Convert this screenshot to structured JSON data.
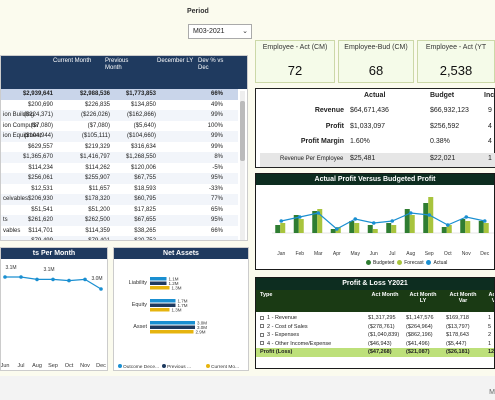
{
  "period": {
    "label": "Period",
    "value": "M03-2021"
  },
  "balance": {
    "headers": [
      "Current Month",
      "Previous Month",
      "December LY",
      "Dev % vs Dec"
    ],
    "rows": [
      {
        "label": "",
        "c1": "$2,939,641",
        "c2": "$2,988,536",
        "c3": "$1,773,853",
        "c4": "66%",
        "style": "total"
      },
      {
        "label": "",
        "c1": "$200,690",
        "c2": "$226,835",
        "c3": "$134,850",
        "c4": "49%",
        "style": ""
      },
      {
        "label": "ion Building",
        "c1": "($224,371)",
        "c2": "($226,026)",
        "c3": "($162,866)",
        "c4": "99%",
        "style": "alt"
      },
      {
        "label": "ion Computer",
        "c1": "($7,080)",
        "c2": "($7,080)",
        "c3": "($5,640)",
        "c4": "100%",
        "style": ""
      },
      {
        "label": "ion Equipment",
        "c1": "($104,944)",
        "c2": "($105,111)",
        "c3": "($104,660)",
        "c4": "99%",
        "style": "alt"
      },
      {
        "label": "",
        "c1": "$629,557",
        "c2": "$219,329",
        "c3": "$316,634",
        "c4": "99%",
        "style": ""
      },
      {
        "label": "",
        "c1": "$1,365,670",
        "c2": "$1,416,797",
        "c3": "$1,268,550",
        "c4": "8%",
        "style": "alt"
      },
      {
        "label": "",
        "c1": "$114,234",
        "c2": "$114,262",
        "c3": "$120,006",
        "c4": "-5%",
        "style": ""
      },
      {
        "label": "",
        "c1": "$256,061",
        "c2": "$255,907",
        "c3": "$67,755",
        "c4": "95%",
        "style": "alt"
      },
      {
        "label": "",
        "c1": "$12,531",
        "c2": "$11,657",
        "c3": "$18,593",
        "c4": "-33%",
        "style": ""
      },
      {
        "label": "ceivables",
        "c1": "$206,930",
        "c2": "$178,320",
        "c3": "$60,795",
        "c4": "77%",
        "style": "alt"
      },
      {
        "label": "",
        "c1": "$51,541",
        "c2": "$51,200",
        "c3": "$17,825",
        "c4": "65%",
        "style": ""
      },
      {
        "label": "ts",
        "c1": "$261,620",
        "c2": "$262,500",
        "c3": "$67,655",
        "c4": "95%",
        "style": "alt"
      },
      {
        "label": "vables",
        "c1": "$114,701",
        "c2": "$114,359",
        "c3": "$38,265",
        "c4": "66%",
        "style": ""
      },
      {
        "label": "",
        "c1": "$79,499",
        "c2": "$79,401",
        "c3": "$20,752",
        "c4": "-",
        "style": "alt"
      },
      {
        "label": "",
        "c1": "$1,675,329",
        "c2": "$1,675,329",
        "c3": "$938,757",
        "c4": "56%",
        "style": "total"
      },
      {
        "label": "",
        "c1": "$1,675,329",
        "c2": "$1,675,329",
        "c3": "$938,757",
        "c4": "",
        "style": ""
      },
      {
        "label": "",
        "c1": "$1,675,329",
        "c2": "$1,675,329",
        "c3": "$938,757",
        "c4": "56%",
        "style": "total"
      },
      {
        "label": "",
        "c1": "$1,311,580",
        "c2": "$1,309,288",
        "c3": "$838,355",
        "c4": "",
        "style": "total"
      }
    ]
  },
  "kpis": [
    {
      "title": "Employee - Act (CM)",
      "value": "72"
    },
    {
      "title": "Employee-Bud (CM)",
      "value": "68"
    },
    {
      "title": "Employee - Act (YT",
      "value": "2,538"
    }
  ],
  "profit_compare": {
    "headers": [
      "Actual",
      "Budget",
      "Inc"
    ],
    "rows": [
      {
        "label": "Revenue",
        "actual": "$64,671,436",
        "budget": "$66,932,123",
        "inc": "9"
      },
      {
        "label": "Profit",
        "actual": "$1,033,097",
        "budget": "$256,592",
        "inc": "4"
      },
      {
        "label": "Profit Margin",
        "actual": "1.60%",
        "budget": "0.38%",
        "inc": "4"
      }
    ],
    "rpe": {
      "label": "Revenue Per Employee",
      "actual": "$25,481",
      "budget": "$22,021",
      "inc": "1"
    }
  },
  "actual_profit_chart": {
    "title": "Actual Profit Versus Budgeted Profit",
    "months": [
      "Jan",
      "Feb",
      "Mar",
      "Apr",
      "May",
      "Jun",
      "Jul",
      "Aug",
      "Sep",
      "Oct",
      "Nov",
      "Dec"
    ],
    "legend": [
      "Budgeted",
      "Forecast",
      "Actual"
    ],
    "colors": {
      "budget": "#2f7d32",
      "forecast": "#a8c43d",
      "actual": "#1a8fd1"
    },
    "chart_data": {
      "type": "bar",
      "categories": [
        "Jan",
        "Feb",
        "Mar",
        "Apr",
        "May",
        "Jun",
        "Jul",
        "Aug",
        "Sep",
        "Oct",
        "Nov",
        "Dec"
      ],
      "series": [
        {
          "name": "Budgeted",
          "values": [
            0.2,
            0.45,
            0.55,
            0.1,
            0.3,
            0.2,
            0.25,
            0.6,
            0.75,
            0.15,
            0.35,
            0.3
          ]
        },
        {
          "name": "Forecast",
          "values": [
            0.25,
            0.35,
            0.6,
            0.15,
            0.25,
            0.1,
            0.2,
            0.45,
            0.9,
            0.2,
            0.3,
            0.25
          ]
        },
        {
          "name": "Actual",
          "values": [
            0.3,
            0.4,
            0.5,
            0.1,
            0.35,
            0.25,
            0.3,
            0.5,
            0.45,
            0.2,
            0.4,
            0.3
          ]
        }
      ]
    }
  },
  "pl": {
    "title": "Profit & Loss Y2021",
    "headers": [
      "Type",
      "Act Month",
      "Act Month LY",
      "Act Month Var",
      "Act M Var"
    ],
    "rows": [
      {
        "label": "1 - Revenue",
        "a": "$1,317,295",
        "b": "$1,147,576",
        "c": "$169,718",
        "d": "1"
      },
      {
        "label": "2 - Cost of Sales",
        "a": "($278,761)",
        "b": "($264,964)",
        "c": "($13,797)",
        "d": "5"
      },
      {
        "label": "3 - Expenses",
        "a": "($1,040,839)",
        "b": "($862,196)",
        "c": "$178,643",
        "d": "2"
      },
      {
        "label": "4 - Other Income/Expense",
        "a": "($46,943)",
        "b": "($41,496)",
        "c": "($5,447)",
        "d": "1"
      }
    ],
    "total": {
      "label": "Profit (Loss)",
      "a": "($47,268)",
      "b": "($21,087)",
      "c": "($26,181)",
      "d": "12"
    }
  },
  "profits_per_month": {
    "title": "ts Per Month",
    "months": [
      "Jun",
      "Jul",
      "Aug",
      "Sep",
      "Oct",
      "Nov",
      "Dec"
    ],
    "labels": [
      "3.1M",
      "3.1M",
      "3.0M"
    ],
    "chart_data": {
      "type": "line",
      "categories": [
        "Jun",
        "Jul",
        "Aug",
        "Sep",
        "Oct",
        "Nov",
        "Dec"
      ],
      "series": [
        {
          "values": [
            3.1,
            3.1,
            3.08,
            3.08,
            3.07,
            3.08,
            3.0
          ]
        }
      ]
    }
  },
  "net_assets": {
    "title": "Net Assets",
    "categories": [
      "Liability",
      "Equity",
      "Asset"
    ],
    "legend": [
      "Outcome Dece...",
      "Previous ...",
      "Current Mo..."
    ],
    "colors": {
      "outcome": "#1a8fd1",
      "previous": "#1f3a5f",
      "current": "#e6b40f"
    },
    "chart_data": {
      "type": "bar",
      "categories": [
        "Liability",
        "Equity",
        "Asset"
      ],
      "series": [
        {
          "name": "Outcome Dece...",
          "values": [
            1.1,
            1.7,
            3.0
          ]
        },
        {
          "name": "Previous ...",
          "values": [
            1.1,
            1.7,
            3.0
          ]
        },
        {
          "name": "Current Mo...",
          "values": [
            1.3,
            1.3,
            2.9
          ]
        }
      ],
      "labels": [
        [
          "1.1M",
          "1.2M",
          "1.3M"
        ],
        [
          "1.7M",
          "1.7M",
          "1.3M"
        ],
        [
          "3.0M",
          "3.0M",
          "2.9M"
        ]
      ]
    }
  },
  "footer": {
    "page": "M"
  }
}
